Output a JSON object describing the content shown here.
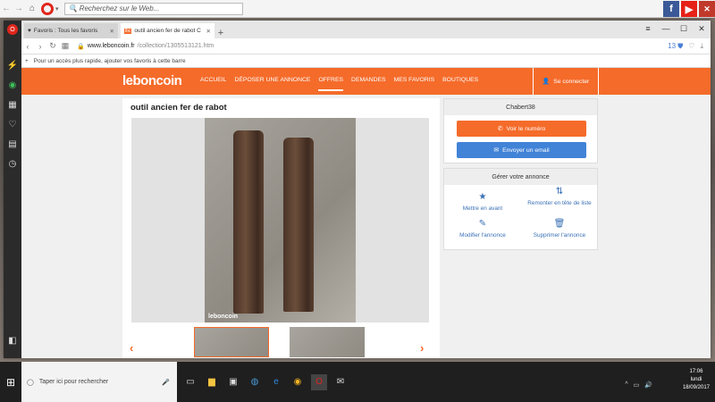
{
  "outer_browser": {
    "search_placeholder": "Recherchez sur le Web...",
    "icons": [
      "back-icon",
      "forward-icon",
      "home-icon",
      "opera-icon",
      "facebook-icon",
      "youtube-icon",
      "gamepad-icon"
    ]
  },
  "tabs": [
    {
      "label": "Favoris : Tous les favoris",
      "icon": "heart-icon"
    },
    {
      "label": "outil ancien fer de rabot C",
      "icon": "leboncoin-icon"
    }
  ],
  "address_bar": {
    "host": "www.leboncoin.fr",
    "path": "/collection/1305513121.htm",
    "badge_count": "13"
  },
  "bookmarks_bar": {
    "hint": "Pour un accès plus rapide, ajouter vos favoris à cette barre"
  },
  "site": {
    "logo": "leboncoin",
    "nav": [
      "ACCUEIL",
      "DÉPOSER UNE ANNONCE",
      "OFFRES",
      "DEMANDES",
      "MES FAVORIS",
      "BOUTIQUES"
    ],
    "active_nav": "OFFRES",
    "connect_label": "Se connecter",
    "brand_color": "#f56b2a"
  },
  "ad": {
    "title": "outil ancien fer de rabot",
    "watermark": "leboncoin"
  },
  "seller": {
    "name": "Chabert38",
    "phone_button": "Voir le numéro",
    "email_button": "Envoyer un email"
  },
  "manage": {
    "title": "Gérer votre annonce",
    "actions": [
      "Mettre en avant",
      "Remonter en tête de liste",
      "Modifier l'annonce",
      "Supprimer l'annonce"
    ]
  },
  "taskbar": {
    "search_placeholder": "Taper ici pour rechercher",
    "time": "17:06",
    "day": "lundi",
    "date": "18/09/2017"
  }
}
